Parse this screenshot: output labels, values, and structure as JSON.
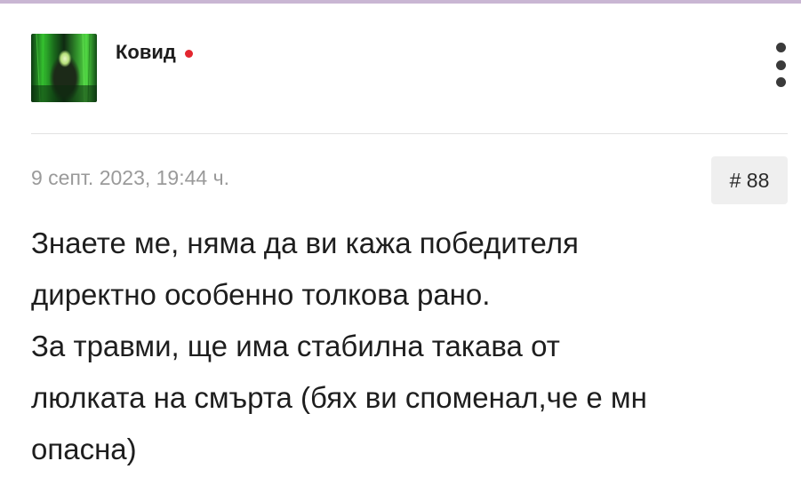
{
  "post": {
    "author": {
      "name": "Ковид",
      "online": true,
      "online_color": "#e3262f"
    },
    "menu_icon": "vertical-ellipsis-icon",
    "timestamp": "9 септ. 2023, 19:44 ч.",
    "number": "# 88",
    "body_lines": [
      "Знаете ме, няма да ви кажа победителя",
      "директно особенно толкова рано.",
      "За травми, ще има стабилна такава от",
      "люлката на смърта (бях ви споменал,че е мн",
      "опасна)"
    ]
  },
  "colors": {
    "top_strip": "#c9b6d3",
    "timestamp": "#9a9a9a",
    "badge_bg": "#efefef"
  }
}
